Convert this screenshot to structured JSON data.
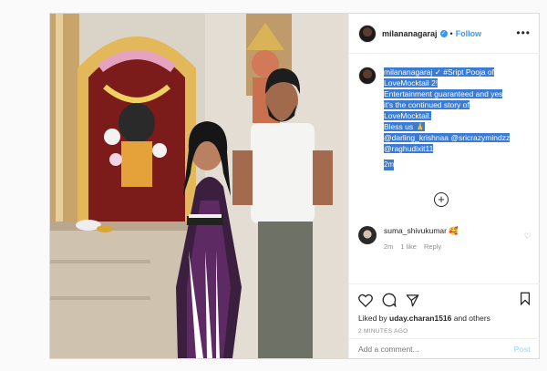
{
  "header": {
    "username": "milananagaraj",
    "verified_mark": "✓",
    "separator": "•",
    "follow_label": "Follow",
    "more_label": "•••"
  },
  "caption": {
    "username": "milananagaraj",
    "lines": [
      "#Sript Pooja of",
      "LoveMocktail 2!",
      "Entertainment guaranteed and yes",
      "it's the continued story of",
      "LoveMocktail.",
      "Bless us 🙏",
      "@darling_krishnaa @sricrazymindzz",
      "@raghudixit11"
    ],
    "time": "2m"
  },
  "load_more_icon": "plus-circle-icon",
  "comment": {
    "username": "suma_shivukumar",
    "emoji": "🥰",
    "time": "2m",
    "likes": "1 like",
    "reply_label": "Reply"
  },
  "actions": {
    "liked_by_prefix": "Liked by ",
    "liked_by_user": "uday.charan1516",
    "liked_by_suffix": " and others",
    "posted_ago": "2 MINUTES AGO"
  },
  "add_comment": {
    "placeholder": "Add a comment...",
    "post_label": "Post"
  },
  "colors": {
    "accent": "#3897f0",
    "highlight": "#3a7bd5",
    "post_disabled": "#b2dffc"
  }
}
